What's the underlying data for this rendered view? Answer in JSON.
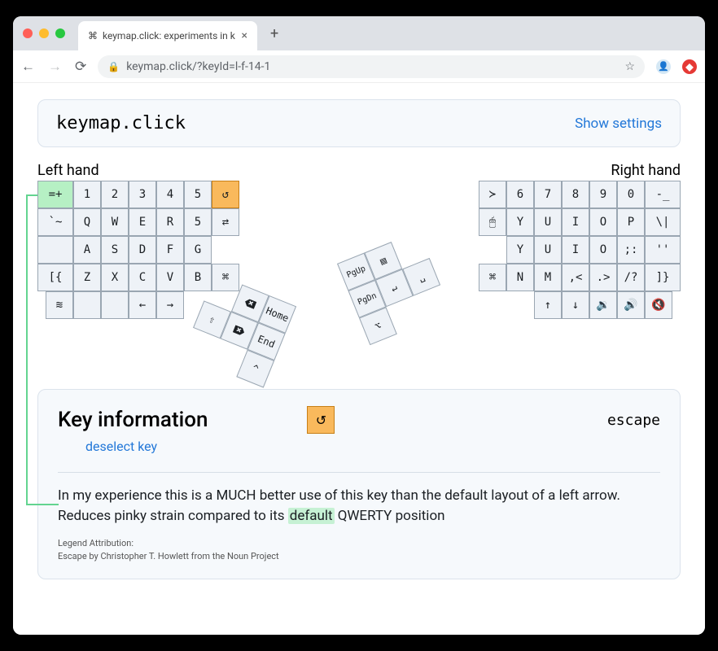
{
  "browser": {
    "tab_title": "keymap.click: experiments in k",
    "url_display": "keymap.click/?keyId=l-f-14-1"
  },
  "header": {
    "title": "keymap.click",
    "settings_label": "Show settings"
  },
  "hands": {
    "left_label": "Left hand",
    "right_label": "Right hand"
  },
  "keys": {
    "left": {
      "row0": [
        "=+",
        "1",
        "2",
        "3",
        "4",
        "5",
        "⟲"
      ],
      "row1": [
        "`~",
        "Q",
        "W",
        "E",
        "R",
        "5",
        "⇆"
      ],
      "row2": [
        "",
        "A",
        "S",
        "D",
        "F",
        "G"
      ],
      "row3": [
        "[{",
        "Z",
        "X",
        "C",
        "V",
        "B",
        "⌘"
      ],
      "row4": [
        "≋",
        "",
        "",
        "←",
        "→"
      ]
    },
    "right": {
      "row0": [
        "≻",
        "6",
        "7",
        "8",
        "9",
        "0",
        "-_"
      ],
      "row1": [
        "🖱",
        "Y",
        "U",
        "I",
        "O",
        "P",
        "\\|"
      ],
      "row2": [
        "Y",
        "U",
        "I",
        "O",
        ";:",
        "''"
      ],
      "row3": [
        "⌘",
        "N",
        "M",
        ",<",
        ".>",
        "/?",
        "]}"
      ],
      "row4": [
        "↑",
        "↓",
        "🔇",
        "🔊",
        "🔈×"
      ]
    },
    "thumbs": {
      "left": [
        "⌫",
        "Home",
        "⇧",
        "⌦",
        "End",
        "^"
      ],
      "right": [
        "PgUp",
        "▤",
        "PgDn",
        "↵",
        "␣",
        "⌥"
      ]
    }
  },
  "info": {
    "title": "Key information",
    "deselect": "deselect key",
    "esc_name": "escape",
    "blurb_a": "In my experience this is a MUCH better use of this key than the default layout of a left arrow. Reduces pinky strain compared to its ",
    "blurb_hl": "default",
    "blurb_b": " QWERTY position",
    "attrib_head": "Legend Attribution:",
    "attrib_body": "Escape by Christopher T. Howlett from the Noun Project"
  }
}
